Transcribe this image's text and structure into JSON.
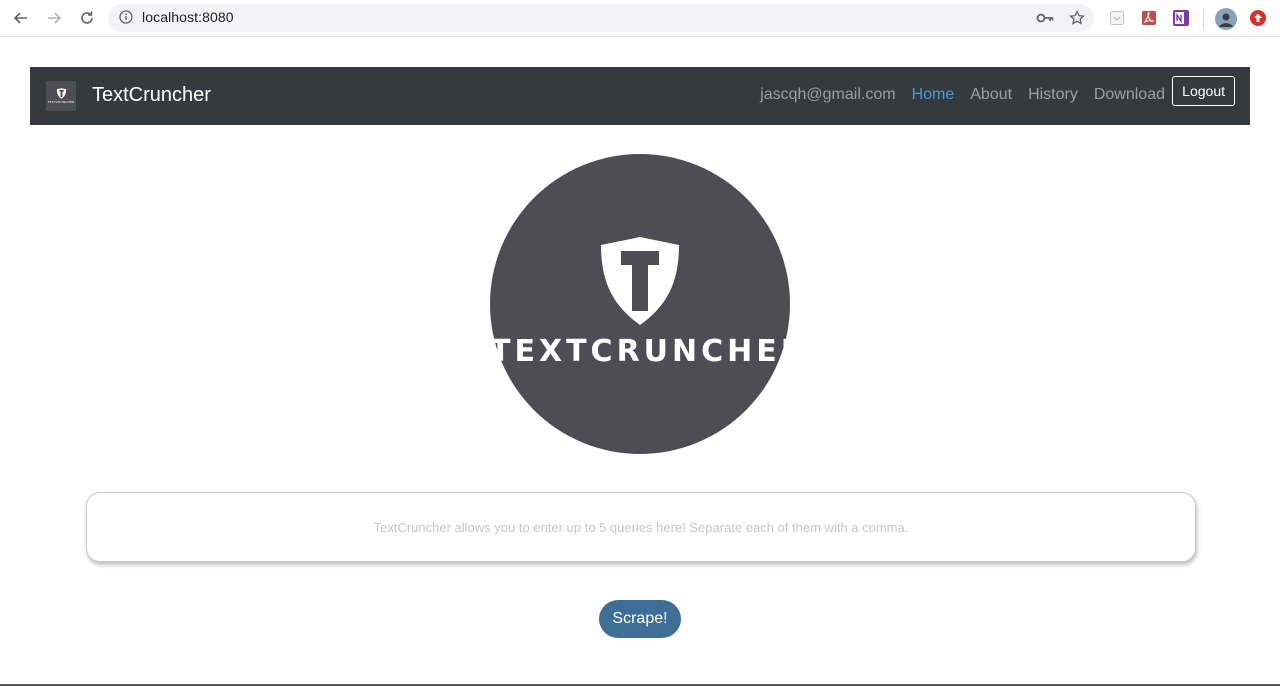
{
  "browser": {
    "url": "localhost:8080",
    "toolbar_icons": [
      "key-icon",
      "star-icon",
      "extension-icon",
      "pdf-icon",
      "onenote-icon",
      "profile-avatar",
      "red-extension-icon"
    ]
  },
  "app": {
    "brand": "TextCruncher",
    "logo_word": "TEXTCRUNCHER",
    "nav": {
      "email": "jascqh@gmail.com",
      "home": "Home",
      "about": "About",
      "history": "History",
      "download": "Download",
      "logout": "Logout",
      "active": "Home"
    },
    "query": {
      "placeholder": "TextCruncher allows you to enter up to 5 queries here! Separate each of them with a comma.",
      "value": ""
    },
    "scrape_label": "Scrape!"
  },
  "colors": {
    "navbar_bg": "#343a40",
    "nav_link": "rgba(255,255,255,0.5)",
    "nav_active": "#4b9ad8",
    "logo_bg": "#4e4d56",
    "button_bg": "#3f6f96"
  }
}
